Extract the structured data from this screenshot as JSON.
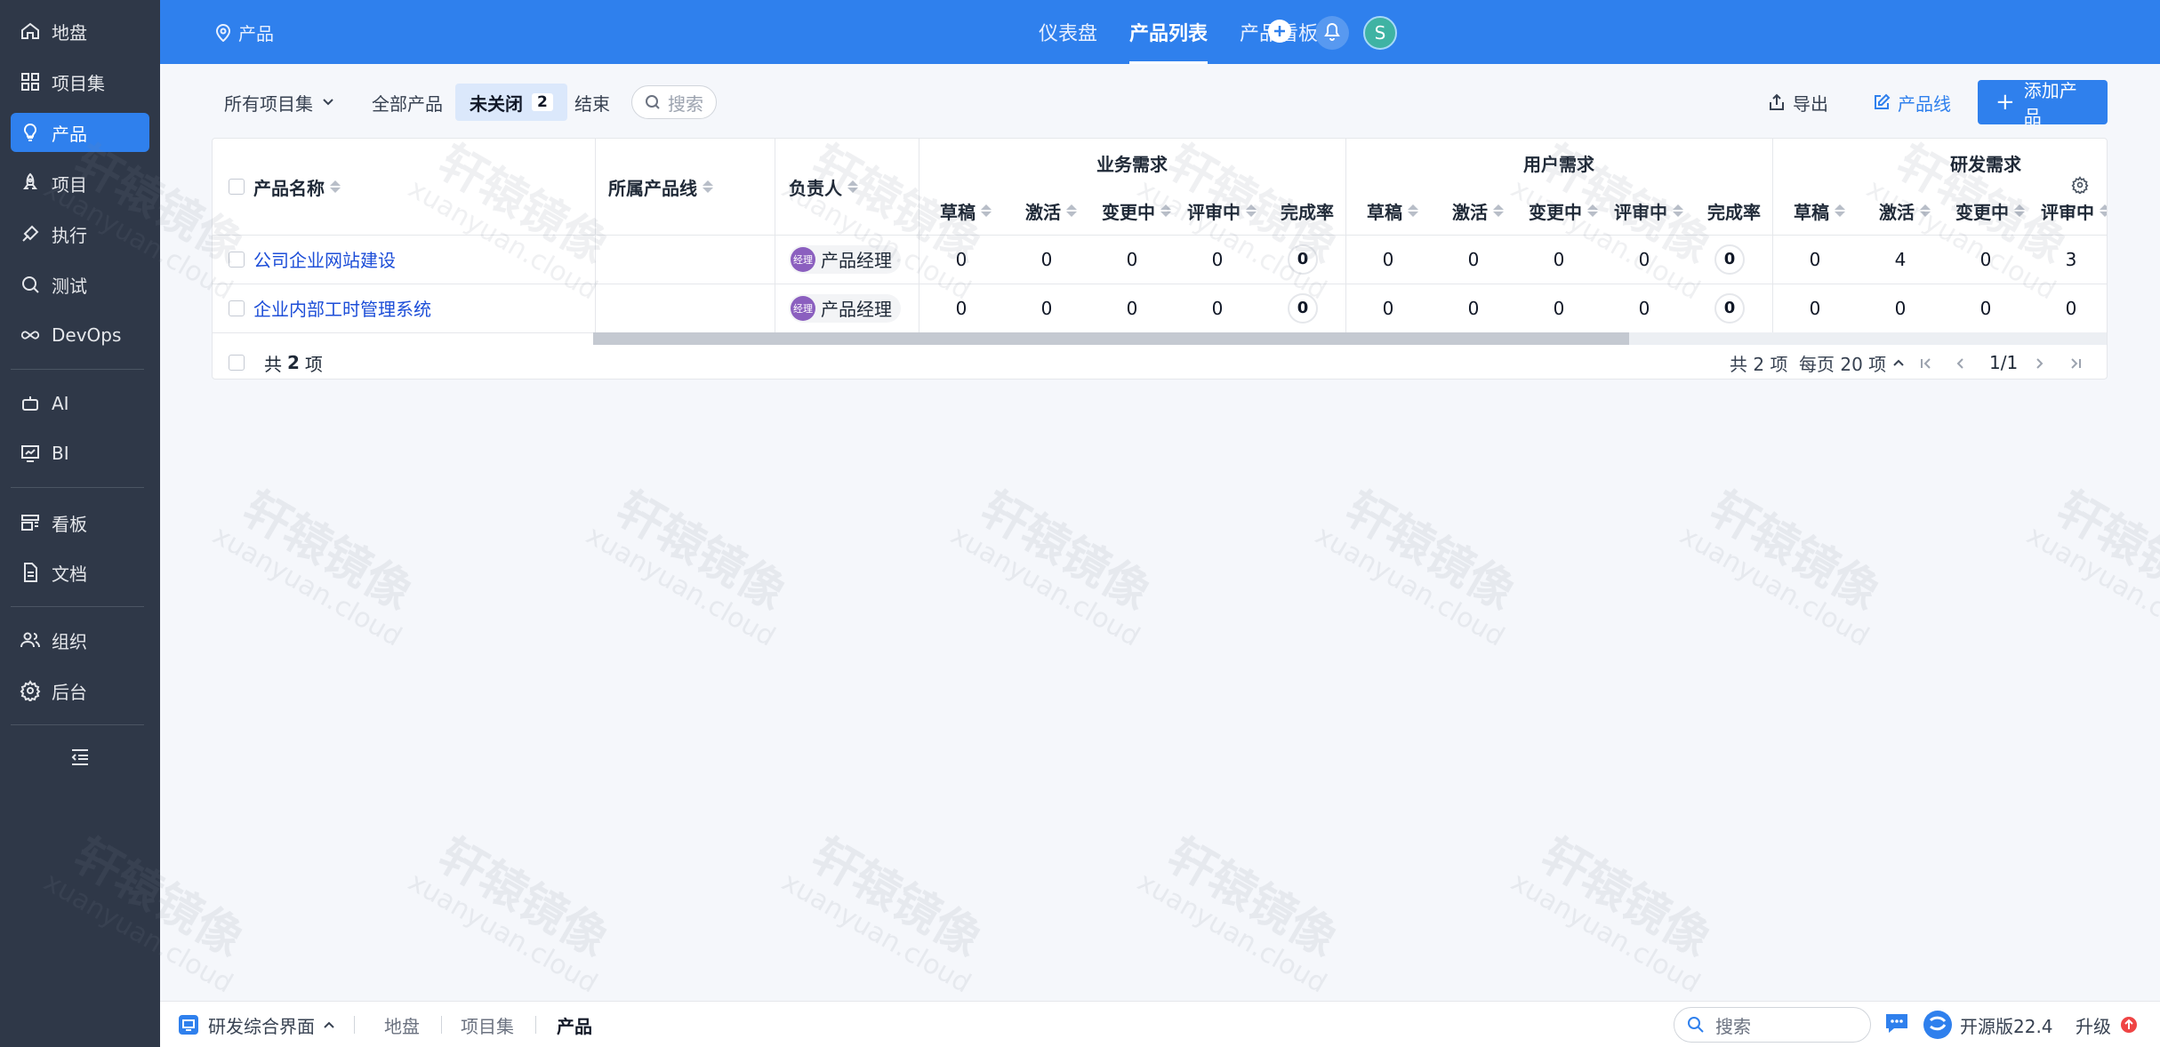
{
  "sidebar": {
    "items": [
      {
        "label": "地盘",
        "icon": "home-icon"
      },
      {
        "label": "项目集",
        "icon": "grid-icon"
      },
      {
        "label": "产品",
        "icon": "bulb-icon",
        "active": true
      },
      {
        "label": "项目",
        "icon": "rocket-icon"
      },
      {
        "label": "执行",
        "icon": "run-icon"
      },
      {
        "label": "测试",
        "icon": "magnifier-icon"
      },
      {
        "label": "DevOps",
        "icon": "infinity-icon"
      },
      {
        "label": "AI",
        "icon": "robot-icon"
      },
      {
        "label": "BI",
        "icon": "chart-screen-icon"
      },
      {
        "label": "看板",
        "icon": "kanban-icon"
      },
      {
        "label": "文档",
        "icon": "document-icon"
      },
      {
        "label": "组织",
        "icon": "people-icon"
      },
      {
        "label": "后台",
        "icon": "gear-icon"
      }
    ]
  },
  "header": {
    "breadcrumb": "产品",
    "tabs": [
      {
        "label": "仪表盘"
      },
      {
        "label": "产品列表",
        "active": true
      },
      {
        "label": "产品看板"
      }
    ],
    "avatar_letter": "S"
  },
  "toolbar": {
    "program_filter": "所有项目集",
    "filters": [
      {
        "label": "全部产品"
      },
      {
        "label": "未关闭",
        "count": "2",
        "active": true
      },
      {
        "label": "结束"
      }
    ],
    "search_placeholder": "搜索",
    "export_label": "导出",
    "product_line_label": "产品线",
    "add_label": "添加产品"
  },
  "table": {
    "columns": {
      "name": "产品名称",
      "line": "所属产品线",
      "owner": "负责人"
    },
    "groups": [
      "业务需求",
      "用户需求",
      "研发需求"
    ],
    "subcolumns": [
      "草稿",
      "激活",
      "变更中",
      "评审中",
      "完成率"
    ],
    "rows": [
      {
        "name": "公司企业网站建设",
        "line": "",
        "owner_badge": "经理",
        "owner": "产品经理",
        "values": [
          "0",
          "0",
          "0",
          "0",
          "0",
          "0",
          "0",
          "0",
          "0",
          "0",
          "0",
          "4",
          "0",
          "3"
        ]
      },
      {
        "name": "企业内部工时管理系统",
        "line": "",
        "owner_badge": "经理",
        "owner": "产品经理",
        "values": [
          "0",
          "0",
          "0",
          "0",
          "0",
          "0",
          "0",
          "0",
          "0",
          "0",
          "0",
          "0",
          "0",
          "0"
        ]
      }
    ],
    "footer": {
      "total_prefix": "共",
      "total_num": "2",
      "total_suffix": "项",
      "pager_total": "共 2 项",
      "page_size": "每页 20 项",
      "page": "1/1"
    }
  },
  "footer_bar": {
    "workspace": "研发综合界面",
    "crumbs": [
      "地盘",
      "项目集",
      "产品"
    ],
    "search_placeholder": "搜索",
    "version": "开源版22.4",
    "upgrade": "升级"
  },
  "watermark": {
    "title": "轩辕镜像",
    "sub": "xuanyuan.cloud"
  },
  "colors": {
    "primary": "#2f80ed",
    "sidebar": "#2f3848"
  }
}
